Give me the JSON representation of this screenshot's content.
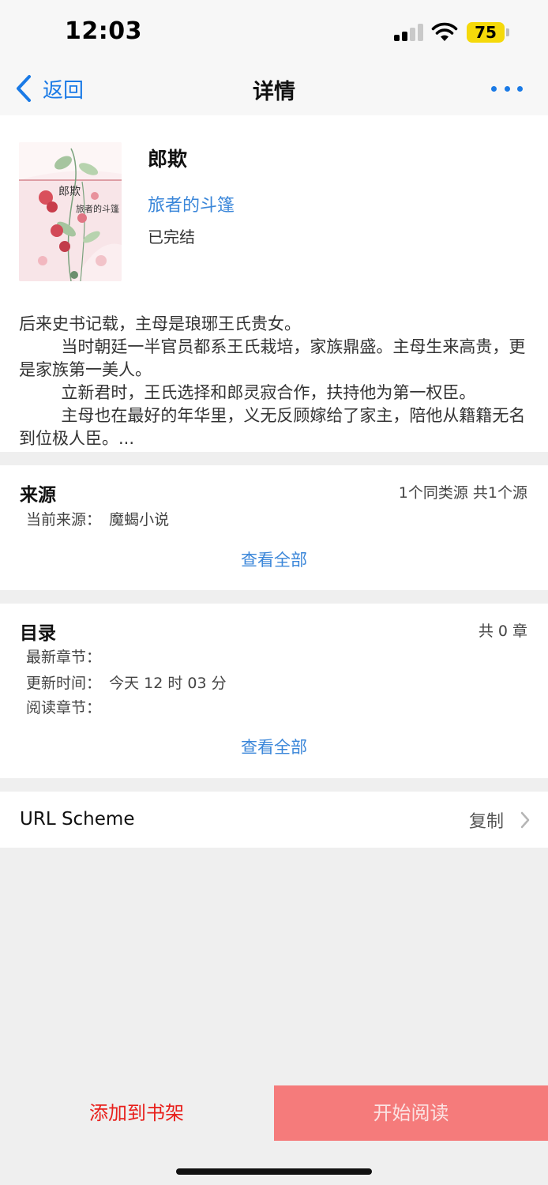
{
  "status_bar": {
    "time": "12:03",
    "battery": "75"
  },
  "nav": {
    "back_label": "返回",
    "title": "详情"
  },
  "book": {
    "title": "郎欺",
    "author": "旅者的斗篷",
    "status": "已完结",
    "cover_title": "郎欺",
    "cover_author": "旅者的斗篷",
    "intro": "后来史书记载，主母是琅琊王氏贵女。\n        当时朝廷一半官员都系王氏栽培，家族鼎盛。主母生来高贵，更是家族第一美人。\n        立新君时，王氏选择和郎灵寂合作，扶持他为第一权臣。\n        主母也在最好的年华里，义无反顾嫁给了家主，陪他从籍籍无名到位极人臣。..."
  },
  "source": {
    "title": "来源",
    "summary": "1个同类源 共1个源",
    "current_label": "当前来源：",
    "current_value": "魔蝎小说",
    "view_all": "查看全部"
  },
  "toc": {
    "title": "目录",
    "count": "共 0 章",
    "latest_label": "最新章节：",
    "latest_value": "",
    "updated_label": "更新时间：",
    "updated_value": "今天 12 时 03 分",
    "reading_label": "阅读章节：",
    "reading_value": "",
    "view_all": "查看全部"
  },
  "url_scheme": {
    "label": "URL Scheme",
    "action": "复制"
  },
  "bottom": {
    "add_shelf": "添加到书架",
    "start_reading": "开始阅读"
  },
  "colors": {
    "accent": "#1a7ae6",
    "link": "#3a86d9",
    "danger": "#e8201c",
    "primary_button": "#f57b7b"
  }
}
